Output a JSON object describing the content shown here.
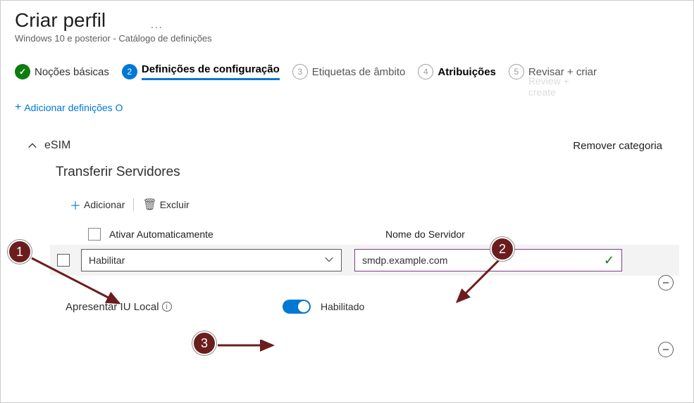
{
  "header": {
    "title": "Criar perfil",
    "subtitle": "Windows 10 e posterior - Catálogo de definições",
    "more_icon": "..."
  },
  "stepper": {
    "steps": [
      {
        "num": "",
        "label": "Noções básicas",
        "state": "complete"
      },
      {
        "num": "2",
        "label": "Definições de configuração",
        "state": "active"
      },
      {
        "num": "3",
        "label": "Etiquetas de âmbito",
        "state": "pending"
      },
      {
        "num": "4",
        "label": "Atribuições",
        "state": "pending-bold"
      },
      {
        "num": "5",
        "label": "Revisar + criar",
        "state": "pending"
      }
    ],
    "ghost_label": "Review + create"
  },
  "actions": {
    "add_settings": "Adicionar definições O"
  },
  "category": {
    "name": "eSIM",
    "remove_label": "Remover categoria",
    "group_title": "Transferir Servidores",
    "toolbar": {
      "add": "Adicionar",
      "delete": "Excluir"
    },
    "columns": {
      "auto_enable": "Ativar Automaticamente",
      "server_name": "Nome do Servidor"
    },
    "row": {
      "dropdown_value": "Habilitar",
      "server_value": "smdp.example.com"
    },
    "local_ui": {
      "label": "Apresentar IU Local",
      "state": "Habilitado"
    }
  },
  "annotations": {
    "b1": "1",
    "b2": "2",
    "b3": "3"
  }
}
